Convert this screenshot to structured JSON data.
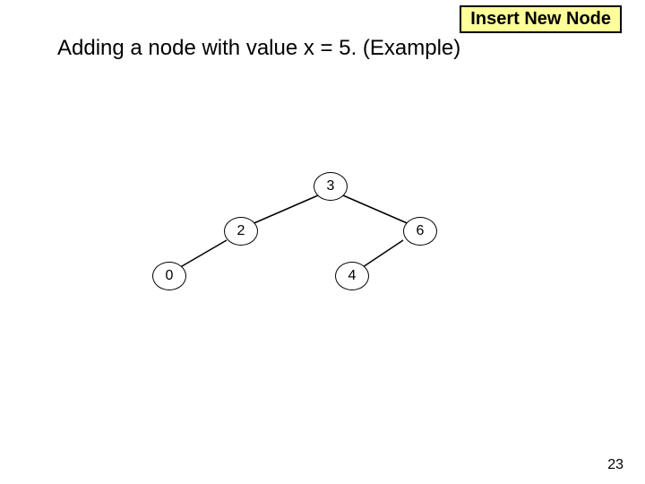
{
  "titleBox": "Insert New Node",
  "heading": "Adding a node with value x = 5. (Example)",
  "tree": {
    "root": "3",
    "left": "2",
    "right": "6",
    "leftLeft": "0",
    "rightLeft": "4"
  },
  "pageNumber": "23"
}
